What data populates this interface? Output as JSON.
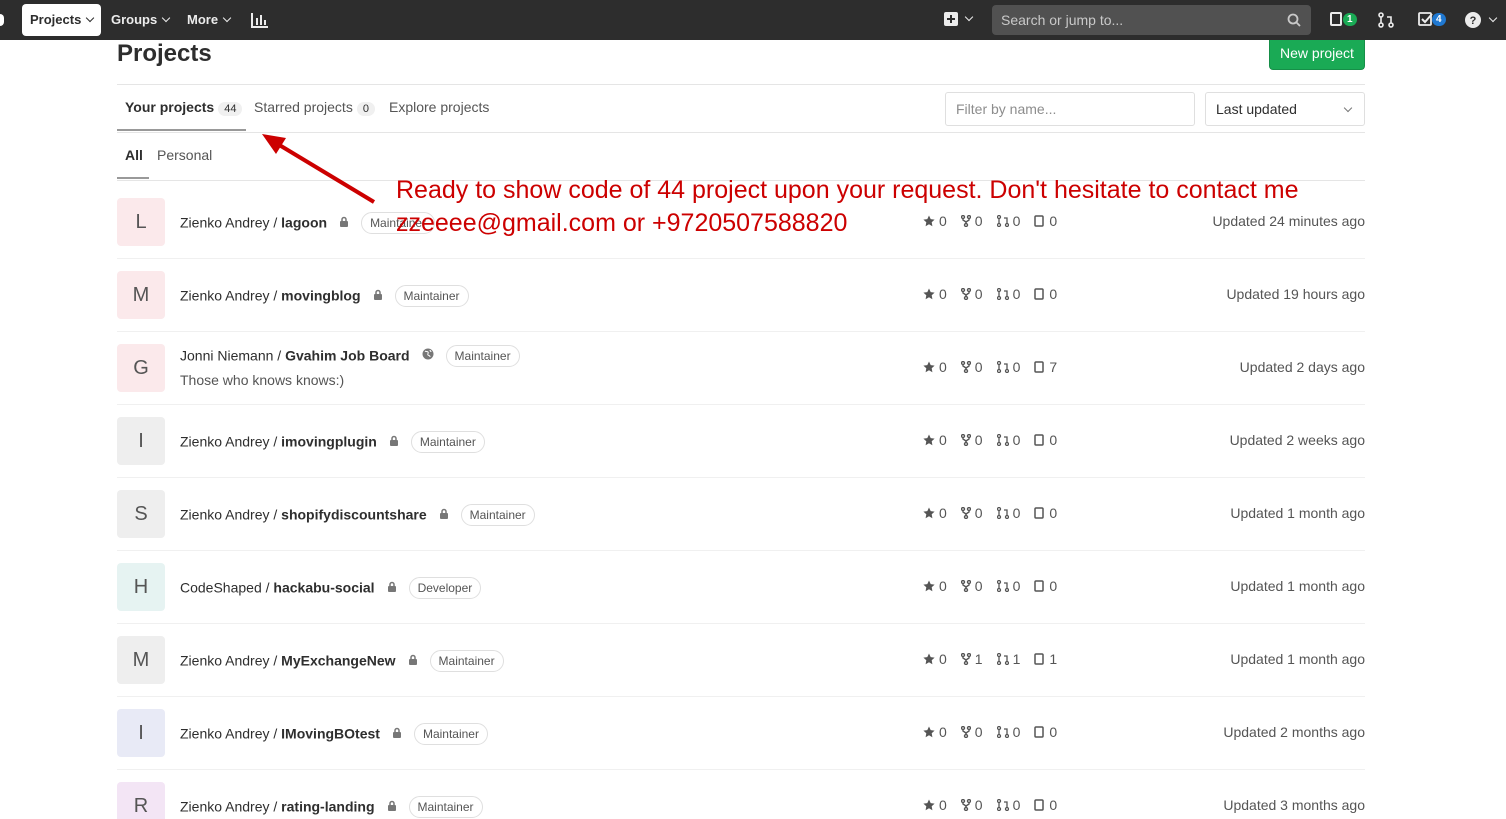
{
  "nav": {
    "projects": "Projects",
    "groups": "Groups",
    "more": "More",
    "search_placeholder": "Search or jump to...",
    "issues_badge": "1",
    "todos_badge": "4"
  },
  "page": {
    "title": "Projects",
    "new_project": "New project"
  },
  "tabs": {
    "your_projects": "Your projects",
    "your_count": "44",
    "starred": "Starred projects",
    "starred_count": "0",
    "explore": "Explore projects",
    "filter_placeholder": "Filter by name...",
    "sort": "Last updated",
    "all": "All",
    "personal": "Personal"
  },
  "annotation": {
    "text": "Ready to show code of 44 project upon your request. Don't hesitate to contact me zzeeee@gmail.com or +9720507588820",
    "color": "#cc0000"
  },
  "projects": [
    {
      "letter": "L",
      "owner": "Zienko Andrey / ",
      "name": "lagoon",
      "role": "Maintainer",
      "desc": "",
      "stars": "0",
      "forks": "0",
      "mrs": "0",
      "issues": "0",
      "updated": "Updated 24 minutes ago",
      "bg": "#fbe9eb"
    },
    {
      "letter": "M",
      "owner": "Zienko Andrey / ",
      "name": "movingblog",
      "role": "Maintainer",
      "desc": "",
      "stars": "0",
      "forks": "0",
      "mrs": "0",
      "issues": "0",
      "updated": "Updated 19 hours ago",
      "bg": "#fbe9eb"
    },
    {
      "letter": "G",
      "owner": "Jonni Niemann / ",
      "name": "Gvahim Job Board",
      "role": "Maintainer",
      "desc": "Those who knows knows:)",
      "stars": "0",
      "forks": "0",
      "mrs": "0",
      "issues": "7",
      "updated": "Updated 2 days ago",
      "bg": "#fbe9eb",
      "public": true
    },
    {
      "letter": "I",
      "owner": "Zienko Andrey / ",
      "name": "imovingplugin",
      "role": "Maintainer",
      "desc": "",
      "stars": "0",
      "forks": "0",
      "mrs": "0",
      "issues": "0",
      "updated": "Updated 2 weeks ago",
      "bg": "#eeeeee"
    },
    {
      "letter": "S",
      "owner": "Zienko Andrey / ",
      "name": "shopifydiscountshare",
      "role": "Maintainer",
      "desc": "",
      "stars": "0",
      "forks": "0",
      "mrs": "0",
      "issues": "0",
      "updated": "Updated 1 month ago",
      "bg": "#eeeeee"
    },
    {
      "letter": "H",
      "owner": "CodeShaped / ",
      "name": "hackabu-social",
      "role": "Developer",
      "desc": "",
      "stars": "0",
      "forks": "0",
      "mrs": "0",
      "issues": "0",
      "updated": "Updated 1 month ago",
      "bg": "#e6f3f2"
    },
    {
      "letter": "M",
      "owner": "Zienko Andrey / ",
      "name": "MyExchangeNew",
      "role": "Maintainer",
      "desc": "",
      "stars": "0",
      "forks": "1",
      "mrs": "1",
      "issues": "1",
      "updated": "Updated 1 month ago",
      "bg": "#eeeeee"
    },
    {
      "letter": "I",
      "owner": "Zienko Andrey / ",
      "name": "IMovingBOtest",
      "role": "Maintainer",
      "desc": "",
      "stars": "0",
      "forks": "0",
      "mrs": "0",
      "issues": "0",
      "updated": "Updated 2 months ago",
      "bg": "#e8eaf6"
    },
    {
      "letter": "R",
      "owner": "Zienko Andrey / ",
      "name": "rating-landing",
      "role": "Maintainer",
      "desc": "",
      "stars": "0",
      "forks": "0",
      "mrs": "0",
      "issues": "0",
      "updated": "Updated 3 months ago",
      "bg": "#f3e5f5"
    }
  ]
}
